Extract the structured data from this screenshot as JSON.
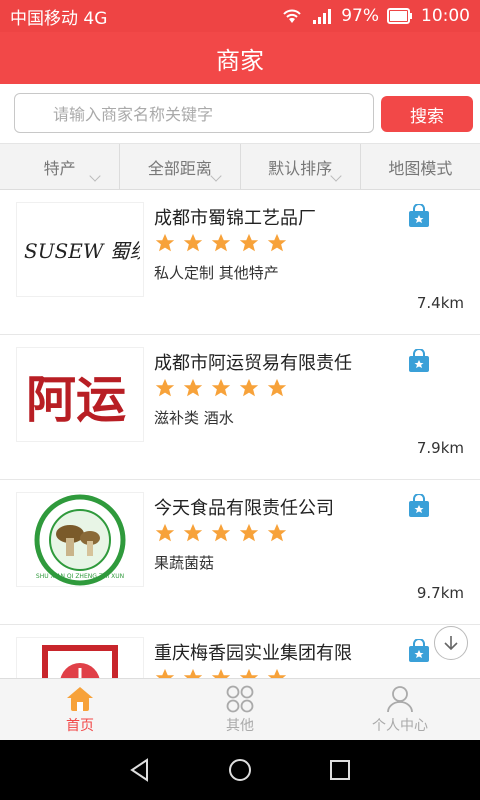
{
  "status_bar": {
    "carrier": "中国移动 4G",
    "battery": "97%",
    "time": "10:00"
  },
  "header": {
    "title": "商家"
  },
  "search": {
    "placeholder": "请输入商家名称关键字",
    "button": "搜索"
  },
  "filters": [
    {
      "label": "特产"
    },
    {
      "label": "全部距离"
    },
    {
      "label": "默认排序"
    },
    {
      "label": "地图模式"
    }
  ],
  "merchants": [
    {
      "name": "成都市蜀锦工艺品厂",
      "tags": "私人定制 其他特产",
      "distance": "7.4km",
      "rating": 5,
      "logo_text": "SUSEW 蜀绣家坊"
    },
    {
      "name": "成都市阿运贸易有限责任",
      "tags": "滋补类 酒水",
      "distance": "7.9km",
      "rating": 5,
      "logo_text": "阿运"
    },
    {
      "name": "今天食品有限责任公司",
      "tags": "果蔬菌菇",
      "distance": "9.7km",
      "rating": 5,
      "logo_text": "SHU XIAN QI ZHENG ZHI XUN"
    },
    {
      "name": "重庆梅香园实业集团有限",
      "tags": "",
      "distance": "",
      "rating": 5,
      "logo_text": ""
    }
  ],
  "tabbar": [
    {
      "label": "首页",
      "icon": "home-icon",
      "active": true
    },
    {
      "label": "其他",
      "icon": "grid-icon",
      "active": false
    },
    {
      "label": "个人中心",
      "icon": "user-icon",
      "active": false
    }
  ],
  "colors": {
    "accent": "#f24848",
    "star": "#f7a23a",
    "bag": "#3aa0d8"
  }
}
